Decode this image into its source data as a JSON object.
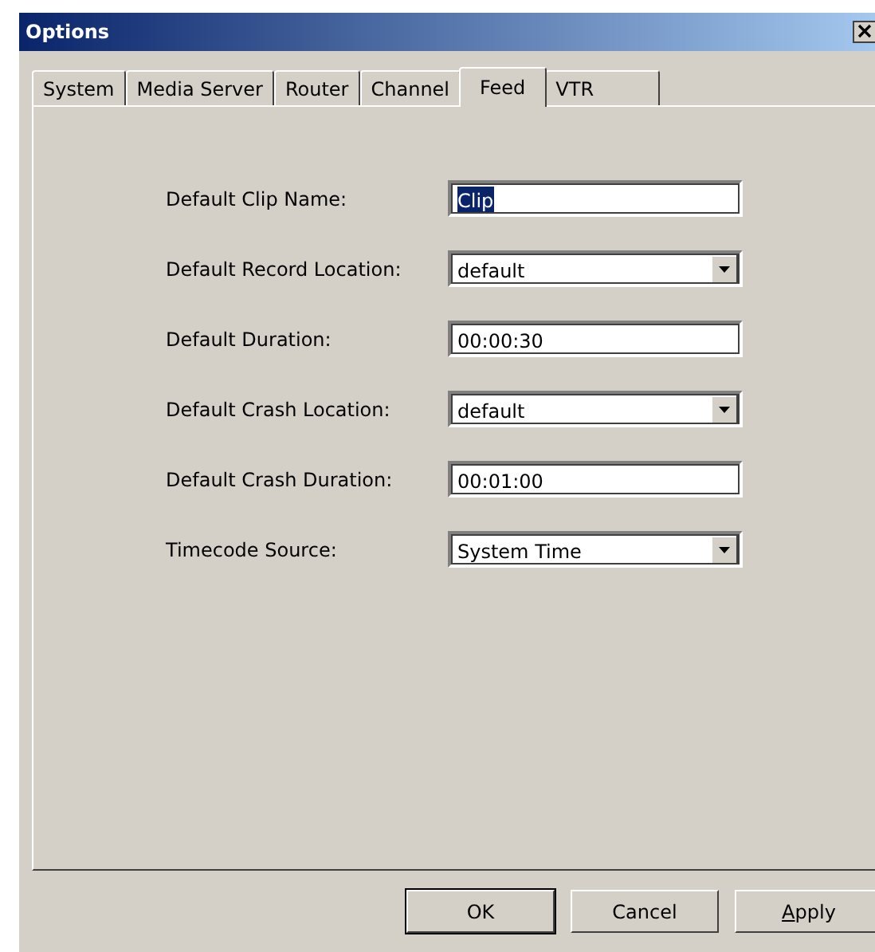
{
  "window": {
    "title": "Options"
  },
  "tabs": [
    {
      "label": "System",
      "selected": false
    },
    {
      "label": "Media Server",
      "selected": false
    },
    {
      "label": "Router",
      "selected": false
    },
    {
      "label": "Channel",
      "selected": false
    },
    {
      "label": "Feed",
      "selected": true
    },
    {
      "label": "VTR",
      "selected": false
    }
  ],
  "fields": [
    {
      "label": "Default Clip Name:",
      "kind": "text",
      "value": "Clip",
      "text_selected": true
    },
    {
      "label": "Default Record Location:",
      "kind": "dropdown",
      "value": "default"
    },
    {
      "label": "Default Duration:",
      "kind": "text",
      "value": "00:00:30",
      "text_selected": false
    },
    {
      "label": "Default Crash Location:",
      "kind": "dropdown",
      "value": "default"
    },
    {
      "label": "Default Crash Duration:",
      "kind": "text",
      "value": "00:01:00",
      "text_selected": false
    },
    {
      "label": "Timecode Source:",
      "kind": "dropdown",
      "value": "System Time"
    }
  ],
  "buttons": [
    {
      "label": "OK",
      "default": true,
      "underline_first": false
    },
    {
      "label": "Cancel",
      "default": false,
      "underline_first": false
    },
    {
      "label": "Apply",
      "default": false,
      "underline_first": true
    }
  ]
}
